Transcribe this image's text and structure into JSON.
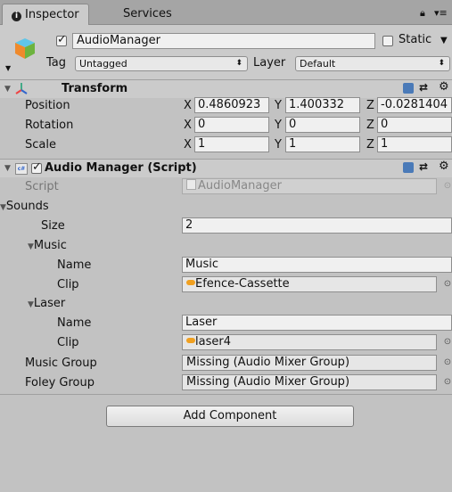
{
  "tabs": [
    {
      "label": "Inspector",
      "icon": "info-icon",
      "active": true
    },
    {
      "label": "Services",
      "active": false
    }
  ],
  "header": {
    "object_name": "AudioManager",
    "active": true,
    "static_label": "Static",
    "static_checked": false,
    "tag_label": "Tag",
    "tag_value": "Untagged",
    "layer_label": "Layer",
    "layer_value": "Default"
  },
  "transform": {
    "title": "Transform",
    "rows": [
      {
        "label": "Position",
        "x": "0.4860923",
        "y": "1.400332",
        "z": "-0.0281404"
      },
      {
        "label": "Rotation",
        "x": "0",
        "y": "0",
        "z": "0"
      },
      {
        "label": "Scale",
        "x": "1",
        "y": "1",
        "z": "1"
      }
    ],
    "axis_labels": {
      "x": "X",
      "y": "Y",
      "z": "Z"
    }
  },
  "audio_manager": {
    "title": "Audio Manager (Script)",
    "enabled": true,
    "script_label": "Script",
    "script_value": "AudioManager",
    "sounds_label": "Sounds",
    "size_label": "Size",
    "size_value": "2",
    "elements": [
      {
        "header": "Music",
        "name_label": "Name",
        "name_value": "Music",
        "clip_label": "Clip",
        "clip_value": "Efence-Cassette"
      },
      {
        "header": "Laser",
        "name_label": "Name",
        "name_value": "Laser",
        "clip_label": "Clip",
        "clip_value": "laser4"
      }
    ],
    "music_group_label": "Music Group",
    "music_group_value": "Missing (Audio Mixer Group)",
    "foley_group_label": "Foley Group",
    "foley_group_value": "Missing (Audio Mixer Group)"
  },
  "add_component_label": "Add Component",
  "colors": {
    "background": "#c2c2c2",
    "header": "#cbcbcb",
    "tabbar": "#a5a5a5",
    "audio_clip_icon": "#f0a020"
  }
}
